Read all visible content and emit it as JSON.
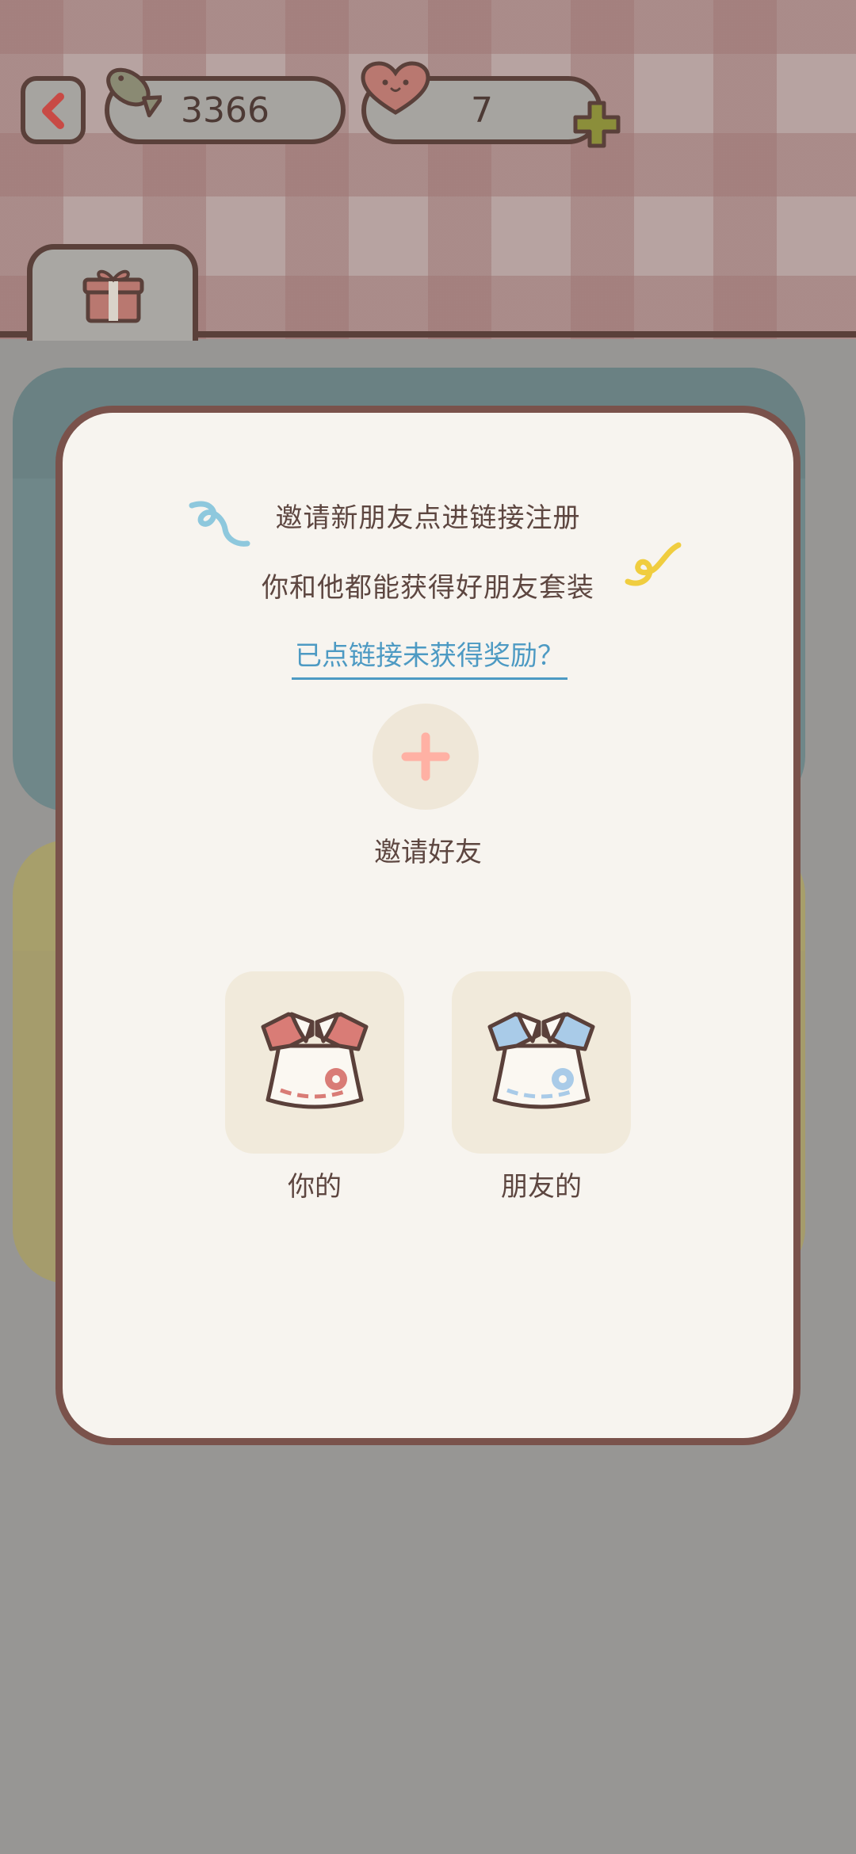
{
  "header": {
    "fish_count": "3366",
    "heart_count": "7"
  },
  "modal": {
    "line1": "邀请新朋友点进链接注册",
    "line2": "你和他都能获得好朋友套装",
    "link_text": "已点链接未获得奖励？",
    "invite_label": "邀请好友",
    "rewards": [
      {
        "label": "你的",
        "color": "#d97c76"
      },
      {
        "label": "朋友的",
        "color": "#a9cbe8"
      }
    ]
  },
  "icons": {
    "back": "back-arrow-icon",
    "fish": "fish-icon",
    "heart": "heart-icon",
    "plus": "plus-icon",
    "gift": "gift-icon",
    "invite_plus": "invite-plus-icon",
    "outfit": "outfit-icon"
  },
  "colors": {
    "accent_plus": "#ffb1a4",
    "link": "#4d9ac3",
    "border": "#5a403a"
  }
}
